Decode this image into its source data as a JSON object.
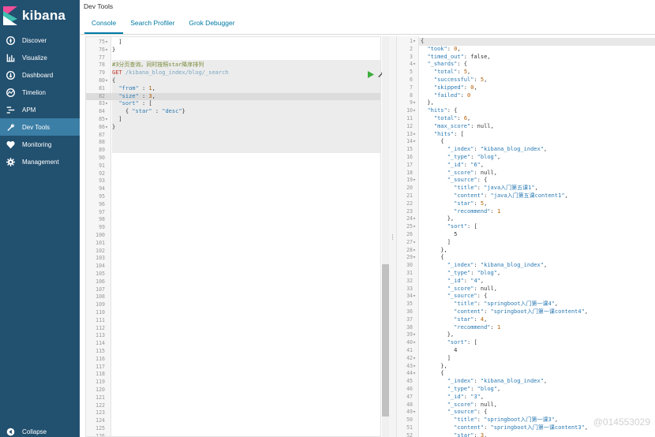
{
  "app": {
    "logo_text": "kibana"
  },
  "sidebar": {
    "items": [
      {
        "label": "Discover",
        "icon": "compass-icon"
      },
      {
        "label": "Visualize",
        "icon": "bar-chart-icon"
      },
      {
        "label": "Dashboard",
        "icon": "dashboard-icon"
      },
      {
        "label": "Timelion",
        "icon": "timelion-icon"
      },
      {
        "label": "APM",
        "icon": "apm-icon"
      },
      {
        "label": "Dev Tools",
        "icon": "wrench-icon",
        "active": true
      },
      {
        "label": "Monitoring",
        "icon": "heartbeat-icon"
      },
      {
        "label": "Management",
        "icon": "gear-icon"
      }
    ],
    "collapse_label": "Collapse"
  },
  "header": {
    "title": "Dev Tools",
    "tabs": [
      {
        "label": "Console",
        "active": true
      },
      {
        "label": "Search Profiler"
      },
      {
        "label": "Grok Debugger"
      }
    ]
  },
  "editor": {
    "lines": [
      {
        "n": "75",
        "fold": true,
        "text": "  ]"
      },
      {
        "n": "76",
        "fold": true,
        "text": "}"
      },
      {
        "n": "77",
        "text": ""
      },
      {
        "n": "78",
        "text": "#3分页查询，同时按照star降序排列"
      },
      {
        "n": "79",
        "text": "GET /kibana_blog_index/blog/_search"
      },
      {
        "n": "80",
        "fold": true,
        "text": "{"
      },
      {
        "n": "81",
        "text": "  \"from\" : 1,"
      },
      {
        "n": "82",
        "text": "  \"size\" : 3,"
      },
      {
        "n": "83",
        "fold": true,
        "text": "  \"sort\" : ["
      },
      {
        "n": "84",
        "text": "    { \"star\" : \"desc\"}"
      },
      {
        "n": "85",
        "fold": true,
        "text": "  ]"
      },
      {
        "n": "86",
        "fold": true,
        "text": "}"
      },
      {
        "n": "87",
        "text": ""
      },
      {
        "n": "88",
        "text": ""
      },
      {
        "n": "89",
        "text": ""
      },
      {
        "n": "90",
        "text": ""
      },
      {
        "n": "91",
        "text": ""
      },
      {
        "n": "92",
        "text": ""
      },
      {
        "n": "93",
        "text": ""
      },
      {
        "n": "94",
        "text": ""
      },
      {
        "n": "95",
        "text": ""
      },
      {
        "n": "96",
        "text": ""
      },
      {
        "n": "97",
        "text": ""
      },
      {
        "n": "98",
        "text": ""
      },
      {
        "n": "99",
        "text": ""
      },
      {
        "n": "100",
        "text": ""
      },
      {
        "n": "101",
        "text": ""
      },
      {
        "n": "102",
        "text": ""
      },
      {
        "n": "103",
        "text": ""
      },
      {
        "n": "104",
        "text": ""
      },
      {
        "n": "105",
        "text": ""
      },
      {
        "n": "106",
        "text": ""
      },
      {
        "n": "107",
        "text": ""
      },
      {
        "n": "108",
        "text": ""
      },
      {
        "n": "109",
        "text": ""
      },
      {
        "n": "110",
        "text": ""
      },
      {
        "n": "111",
        "text": ""
      },
      {
        "n": "112",
        "text": ""
      },
      {
        "n": "113",
        "text": ""
      },
      {
        "n": "114",
        "text": ""
      },
      {
        "n": "115",
        "text": ""
      },
      {
        "n": "116",
        "text": ""
      },
      {
        "n": "117",
        "text": ""
      },
      {
        "n": "118",
        "text": ""
      },
      {
        "n": "119",
        "text": ""
      },
      {
        "n": "120",
        "text": ""
      },
      {
        "n": "121",
        "text": ""
      },
      {
        "n": "122",
        "text": ""
      },
      {
        "n": "123",
        "text": ""
      },
      {
        "n": "124",
        "text": ""
      },
      {
        "n": "125",
        "text": ""
      },
      {
        "n": "126",
        "text": ""
      }
    ]
  },
  "output": {
    "lines": [
      {
        "n": "1",
        "fold": true,
        "text": "{"
      },
      {
        "n": "2",
        "text": "  \"took\": 0,"
      },
      {
        "n": "3",
        "text": "  \"timed_out\": false,"
      },
      {
        "n": "4",
        "fold": true,
        "text": "  \"_shards\": {"
      },
      {
        "n": "5",
        "text": "    \"total\": 5,"
      },
      {
        "n": "6",
        "text": "    \"successful\": 5,"
      },
      {
        "n": "7",
        "text": "    \"skipped\": 0,"
      },
      {
        "n": "8",
        "text": "    \"failed\": 0"
      },
      {
        "n": "9",
        "fold": true,
        "text": "  },"
      },
      {
        "n": "10",
        "fold": true,
        "text": "  \"hits\": {"
      },
      {
        "n": "11",
        "text": "    \"total\": 6,"
      },
      {
        "n": "12",
        "text": "    \"max_score\": null,"
      },
      {
        "n": "13",
        "fold": true,
        "text": "    \"hits\": ["
      },
      {
        "n": "14",
        "fold": true,
        "text": "      {"
      },
      {
        "n": "15",
        "text": "        \"_index\": \"kibana_blog_index\","
      },
      {
        "n": "16",
        "text": "        \"_type\": \"blog\","
      },
      {
        "n": "17",
        "text": "        \"_id\": \"6\","
      },
      {
        "n": "18",
        "text": "        \"_score\": null,"
      },
      {
        "n": "19",
        "fold": true,
        "text": "        \"_source\": {"
      },
      {
        "n": "20",
        "text": "          \"title\": \"java入门第五课1\","
      },
      {
        "n": "21",
        "text": "          \"content\": \"java入门第五课content1\","
      },
      {
        "n": "22",
        "text": "          \"star\": 5,"
      },
      {
        "n": "23",
        "text": "          \"recommend\": 1"
      },
      {
        "n": "24",
        "fold": true,
        "text": "        },"
      },
      {
        "n": "25",
        "fold": true,
        "text": "        \"sort\": ["
      },
      {
        "n": "26",
        "text": "          5"
      },
      {
        "n": "27",
        "fold": true,
        "text": "        ]"
      },
      {
        "n": "28",
        "fold": true,
        "text": "      },"
      },
      {
        "n": "29",
        "fold": true,
        "text": "      {"
      },
      {
        "n": "30",
        "text": "        \"_index\": \"kibana_blog_index\","
      },
      {
        "n": "31",
        "text": "        \"_type\": \"blog\","
      },
      {
        "n": "32",
        "text": "        \"_id\": \"4\","
      },
      {
        "n": "33",
        "text": "        \"_score\": null,"
      },
      {
        "n": "34",
        "fold": true,
        "text": "        \"_source\": {"
      },
      {
        "n": "35",
        "text": "          \"title\": \"springboot入门第一课4\","
      },
      {
        "n": "36",
        "text": "          \"content\": \"springboot入门第一课content4\","
      },
      {
        "n": "37",
        "text": "          \"star\": 4,"
      },
      {
        "n": "38",
        "text": "          \"recommend\": 1"
      },
      {
        "n": "39",
        "fold": true,
        "text": "        },"
      },
      {
        "n": "40",
        "fold": true,
        "text": "        \"sort\": ["
      },
      {
        "n": "41",
        "text": "          4"
      },
      {
        "n": "42",
        "fold": true,
        "text": "        ]"
      },
      {
        "n": "43",
        "fold": true,
        "text": "      },"
      },
      {
        "n": "44",
        "fold": true,
        "text": "      {"
      },
      {
        "n": "45",
        "text": "        \"_index\": \"kibana_blog_index\","
      },
      {
        "n": "46",
        "text": "        \"_type\": \"blog\","
      },
      {
        "n": "47",
        "text": "        \"_id\": \"3\","
      },
      {
        "n": "48",
        "text": "        \"_score\": null,"
      },
      {
        "n": "49",
        "fold": true,
        "text": "        \"_source\": {"
      },
      {
        "n": "50",
        "text": "          \"title\": \"springboot入门第一课3\","
      },
      {
        "n": "51",
        "text": "          \"content\": \"springboot入门第一课content3\","
      },
      {
        "n": "52",
        "text": "          \"star\": 3,"
      }
    ]
  },
  "watermark": "@014553029",
  "colors": {
    "sidebar_bg": "#22506f",
    "sidebar_active": "#3b7ea6",
    "tab_accent": "#0079a5",
    "play_green": "#3cae3c"
  }
}
